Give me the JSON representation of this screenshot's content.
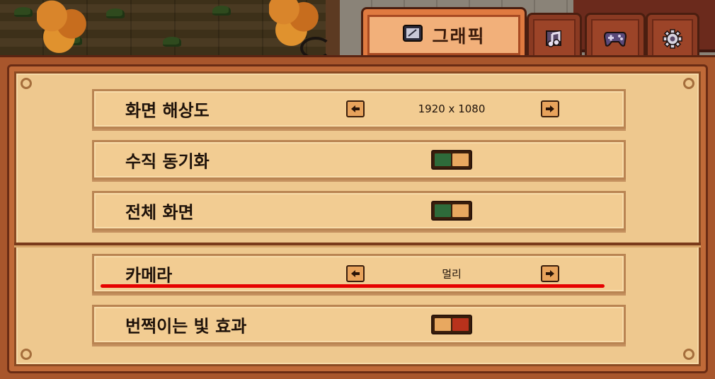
{
  "tabs": [
    {
      "name": "graphics",
      "label": "그래픽",
      "icon": "monitor-icon",
      "active": true
    },
    {
      "name": "audio",
      "label": "",
      "icon": "music-note-icon",
      "active": false
    },
    {
      "name": "controls",
      "label": "",
      "icon": "gamepad-icon",
      "active": false
    },
    {
      "name": "general",
      "label": "",
      "icon": "gear-icon",
      "active": false
    }
  ],
  "settings": {
    "resolution": {
      "label": "화면 해상도",
      "value": "1920 x 1080"
    },
    "vsync": {
      "label": "수직 동기화",
      "state": "on"
    },
    "fullscreen": {
      "label": "전체 화면",
      "state": "on"
    },
    "camera": {
      "label": "카메라",
      "value": "멀리"
    },
    "flash_effect": {
      "label": "번쩍이는 빛 효과",
      "state": "off"
    }
  },
  "colors": {
    "toggle_on": "#2e6b3a",
    "toggle_off": "#b8321c",
    "toggle_knob": "#e8a860",
    "highlight_underline": "#e60000"
  }
}
